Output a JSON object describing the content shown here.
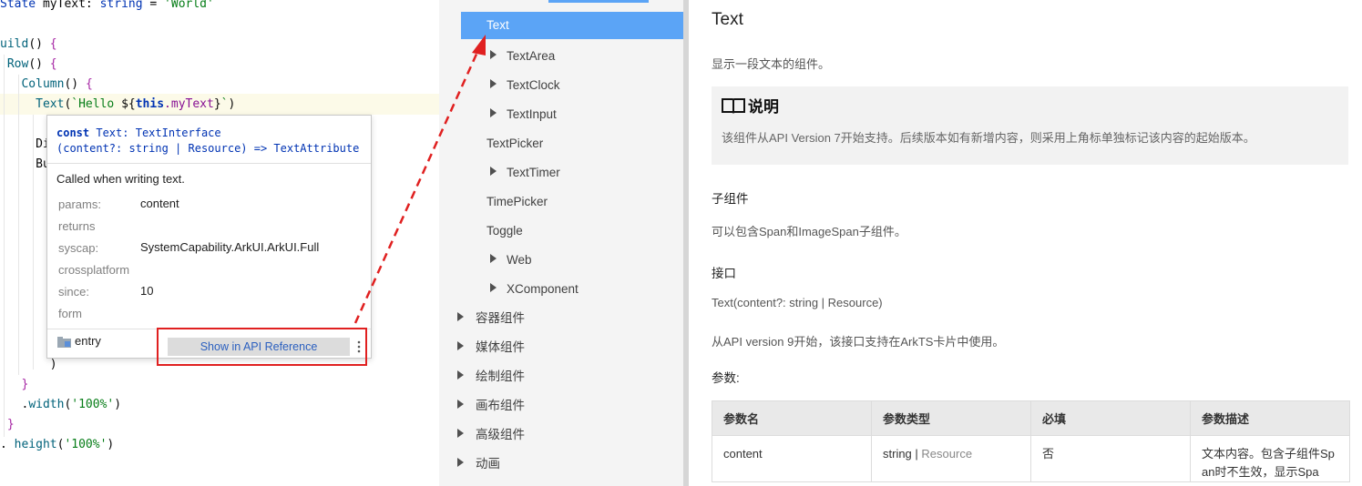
{
  "editor": {
    "lines": [
      {
        "id": "l1",
        "parts": [
          [
            "kw",
            "State "
          ],
          [
            "",
            "myText: "
          ],
          [
            "kw",
            "string"
          ],
          [
            "",
            " = "
          ],
          [
            "str",
            "'World'"
          ]
        ]
      },
      {
        "id": "l2",
        "parts": [
          [
            "fn",
            "uild"
          ],
          [
            "",
            "() "
          ],
          [
            "br",
            "{"
          ]
        ]
      },
      {
        "id": "l3",
        "parts": [
          [
            "fn",
            " Row"
          ],
          [
            "",
            "() "
          ],
          [
            "br",
            "{"
          ]
        ]
      },
      {
        "id": "l4",
        "parts": [
          [
            "fn",
            "   Column"
          ],
          [
            "",
            "() "
          ],
          [
            "br",
            "{"
          ]
        ]
      },
      {
        "id": "l5",
        "parts": [
          [
            "fn",
            "     Text"
          ],
          [
            "",
            "("
          ],
          [
            "str",
            "`Hello "
          ],
          [
            "",
            "${"
          ],
          [
            "kwb",
            "this"
          ],
          [
            "",
            ""
          ],
          [
            "var",
            ".myText"
          ],
          [
            "",
            "}"
          ],
          [
            "str",
            "`"
          ],
          [
            "",
            ")"
          ]
        ]
      },
      {
        "id": "l6",
        "parts": [
          [
            "",
            "     Di"
          ]
        ]
      },
      {
        "id": "l7",
        "parts": [
          [
            "",
            "     Bu"
          ]
        ]
      },
      {
        "id": "l8",
        "parts": [
          [
            "",
            "       )"
          ]
        ]
      },
      {
        "id": "l9",
        "parts": [
          [
            "br",
            "   }"
          ]
        ]
      },
      {
        "id": "l10",
        "parts": [
          [
            "",
            "   ."
          ],
          [
            "fn",
            "width"
          ],
          [
            "",
            "("
          ],
          [
            "str",
            "'100%'"
          ],
          [
            "",
            ")"
          ]
        ]
      },
      {
        "id": "l11",
        "parts": [
          [
            "br",
            " }"
          ]
        ]
      },
      {
        "id": "l12",
        "parts": [
          [
            "",
            ". "
          ],
          [
            "fn",
            "height"
          ],
          [
            "",
            "("
          ],
          [
            "str",
            "'100%'"
          ],
          [
            "",
            ")"
          ]
        ]
      }
    ]
  },
  "popup": {
    "sig_line1_kw": "const ",
    "sig_line1_name": "Text",
    "sig_line1_rest": ": TextInterface",
    "sig_line2": "(content?: string | Resource) => TextAttribute",
    "description": "Called when writing text.",
    "fields": [
      {
        "key": "params:",
        "value": "content"
      },
      {
        "key": "returns",
        "value": ""
      },
      {
        "key": "syscap:",
        "value": "SystemCapability.ArkUI.ArkUI.Full"
      },
      {
        "key": "crossplatform",
        "value": ""
      },
      {
        "key": "since:",
        "value": "10"
      },
      {
        "key": "form",
        "value": ""
      }
    ],
    "module": "entry",
    "api_button": "Show in API Reference"
  },
  "nav": {
    "items": [
      {
        "label": "Text",
        "arrow": false,
        "selected": true,
        "indent": 2
      },
      {
        "label": "TextArea",
        "arrow": true,
        "indent": 2
      },
      {
        "label": "TextClock",
        "arrow": true,
        "indent": 2
      },
      {
        "label": "TextInput",
        "arrow": true,
        "indent": 2
      },
      {
        "label": "TextPicker",
        "arrow": false,
        "indent": 2
      },
      {
        "label": "TextTimer",
        "arrow": true,
        "indent": 2
      },
      {
        "label": "TimePicker",
        "arrow": false,
        "indent": 2
      },
      {
        "label": "Toggle",
        "arrow": false,
        "indent": 2
      },
      {
        "label": "Web",
        "arrow": true,
        "indent": 2
      },
      {
        "label": "XComponent",
        "arrow": true,
        "indent": 2
      },
      {
        "label": "容器组件",
        "arrow": true,
        "indent": 1
      },
      {
        "label": "媒体组件",
        "arrow": true,
        "indent": 1
      },
      {
        "label": "绘制组件",
        "arrow": true,
        "indent": 1
      },
      {
        "label": "画布组件",
        "arrow": true,
        "indent": 1
      },
      {
        "label": "高级组件",
        "arrow": true,
        "indent": 1
      },
      {
        "label": "动画",
        "arrow": true,
        "indent": 1
      }
    ]
  },
  "doc": {
    "title": "Text",
    "intro": "显示一段文本的组件。",
    "note_title": "说明",
    "note_body": "该组件从API Version 7开始支持。后续版本如有新增内容，则采用上角标单独标记该内容的起始版本。",
    "child_heading": "子组件",
    "child_text": "可以包含Span和ImageSpan子组件。",
    "iface_heading": "接口",
    "iface_sig": "Text(content?: string | Resource)",
    "iface_note": "从API version 9开始，该接口支持在ArkTS卡片中使用。",
    "params_heading": "参数:",
    "table": {
      "headers": [
        "参数名",
        "参数类型",
        "必填",
        "参数描述"
      ],
      "row": {
        "name": "content",
        "type_a": "string",
        "type_sep": " | ",
        "type_b": "Resource",
        "required": "否",
        "desc": "文本内容。包含子组件Span时不生效，显示Spa"
      }
    }
  },
  "colors": {
    "selection": "#5ba4f6",
    "annotation": "#e02020",
    "link": "#2a5fbf"
  }
}
